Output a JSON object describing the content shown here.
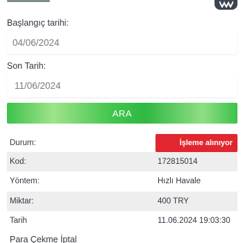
{
  "form": {
    "start_label": "Başlangıç tarihi:",
    "start_value": "04/06/2024",
    "end_label": "Son Tarih:",
    "end_value": "11/06/2024",
    "search_label": "ARA"
  },
  "details": {
    "status_label": "Durum:",
    "status_value": "İşleme alınıyor",
    "code_label": "Kod:",
    "code_value": "172815014",
    "method_label": "Yöntem:",
    "method_value": "Hızlı Havale",
    "amount_label": "Miktar:",
    "amount_value": "400 TRY",
    "date_label": "Tarih",
    "date_value": "11.06.2024 19:03:30"
  },
  "footer": {
    "section_title": "Para Çekme İptal"
  },
  "colors": {
    "status_badge": "#e2262f",
    "search_button": "#3cc24a",
    "row_shade": "#eeeeee"
  },
  "icons": {
    "top_logo": "brand-logo-icon"
  }
}
